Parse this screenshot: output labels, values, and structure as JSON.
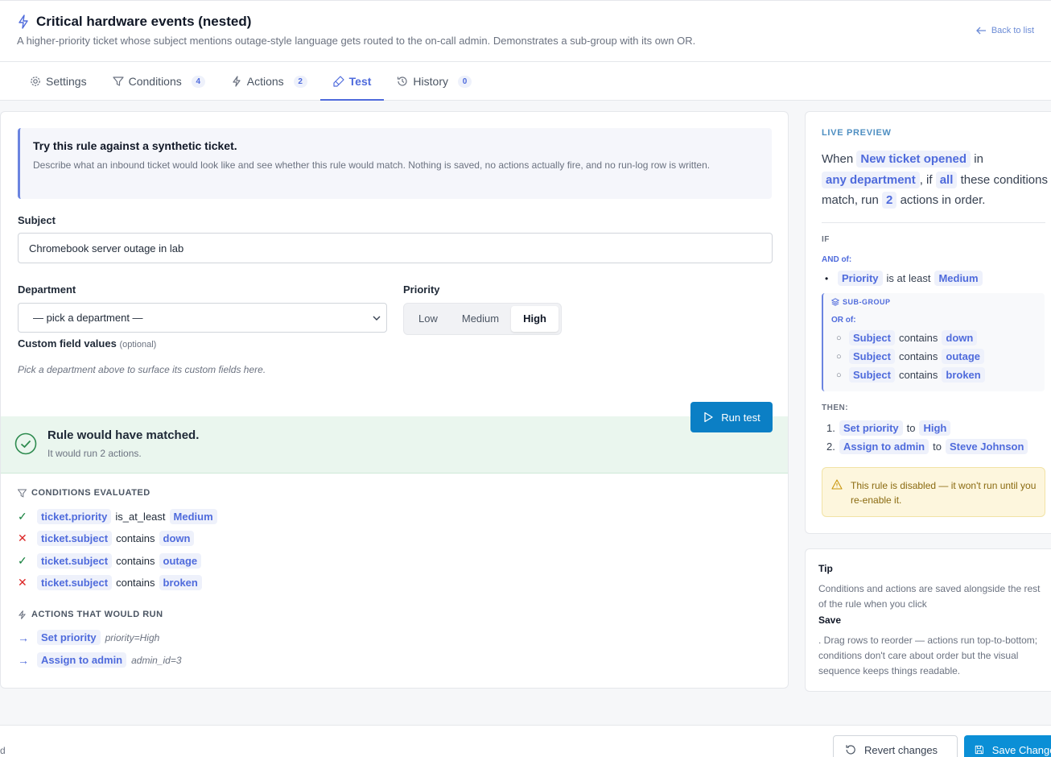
{
  "header": {
    "title": "Critical hardware events (nested)",
    "subtitle": "A higher-priority ticket whose subject mentions outage-style language gets routed to the on-call admin. Demonstrates a sub-group with its own OR.",
    "back_label": "Back to list"
  },
  "tabs": [
    {
      "label": "Settings",
      "count": ""
    },
    {
      "label": "Conditions",
      "count": "4"
    },
    {
      "label": "Actions",
      "count": "2"
    },
    {
      "label": "Test",
      "count": ""
    },
    {
      "label": "History",
      "count": "0"
    }
  ],
  "test": {
    "info_title": "Try this rule against a synthetic ticket.",
    "info_text": "Describe what an inbound ticket would look like and see whether this rule would match. Nothing is saved, no actions actually fire, and no run-log row is written.",
    "subject_label": "Subject",
    "subject_value": "Chromebook server outage in lab",
    "department_label": "Department",
    "department_value": "— pick a department —",
    "priority_label": "Priority",
    "priority_options": [
      "Low",
      "Medium",
      "High"
    ],
    "priority_selected": "High",
    "custom_label": "Custom field values",
    "custom_optional": "(optional)",
    "custom_hint": "Pick a department above to surface its custom fields here.",
    "run_label": "Run test"
  },
  "result": {
    "title": "Rule would have matched.",
    "subtitle": "It would run 2 actions.",
    "conditions_head": "CONDITIONS EVALUATED",
    "conditions": [
      {
        "status": "pass",
        "field": "ticket.priority",
        "op": "is_at_least",
        "value": "Medium"
      },
      {
        "status": "fail",
        "field": "ticket.subject",
        "op": "contains",
        "value": "down"
      },
      {
        "status": "pass",
        "field": "ticket.subject",
        "op": "contains",
        "value": "outage"
      },
      {
        "status": "fail",
        "field": "ticket.subject",
        "op": "contains",
        "value": "broken"
      }
    ],
    "actions_head": "ACTIONS THAT WOULD RUN",
    "actions": [
      {
        "label": "Set priority",
        "param": "priority=High"
      },
      {
        "label": "Assign to admin",
        "param": "admin_id=3"
      }
    ]
  },
  "preview": {
    "head": "LIVE PREVIEW",
    "s_when": "When",
    "trigger": "New ticket opened",
    "s_in": "in",
    "scope": "any department",
    "s_if": ", if",
    "match": "all",
    "s_these": "these conditions match, run",
    "count": "2",
    "s_actions": "actions in order.",
    "if_kw": "IF",
    "and_of": "AND of:",
    "top_condition": {
      "field": "Priority",
      "op": "is at least",
      "value": "Medium"
    },
    "subgroup_label": "SUB-GROUP",
    "or_of": "OR of:",
    "or_conditions": [
      {
        "field": "Subject",
        "op": "contains",
        "value": "down"
      },
      {
        "field": "Subject",
        "op": "contains",
        "value": "outage"
      },
      {
        "field": "Subject",
        "op": "contains",
        "value": "broken"
      }
    ],
    "then_kw": "THEN:",
    "then_actions": [
      {
        "n": "1.",
        "action": "Set priority",
        "to": "to",
        "value": "High"
      },
      {
        "n": "2.",
        "action": "Assign to admin",
        "to": "to",
        "value": "Steve Johnson"
      }
    ],
    "warning": "This rule is disabled — it won't run until you re-enable it."
  },
  "tip": {
    "title": "Tip",
    "text1": "Conditions and actions are saved alongside the rest of the rule when you click",
    "save_word": "Save",
    "text2": ". Drag rows to reorder — actions run top-to-bottom; conditions don't care about order but the visual sequence keeps things readable."
  },
  "footer": {
    "left_text": "d",
    "revert_label": "Revert changes",
    "save_label": "Save Changes"
  }
}
